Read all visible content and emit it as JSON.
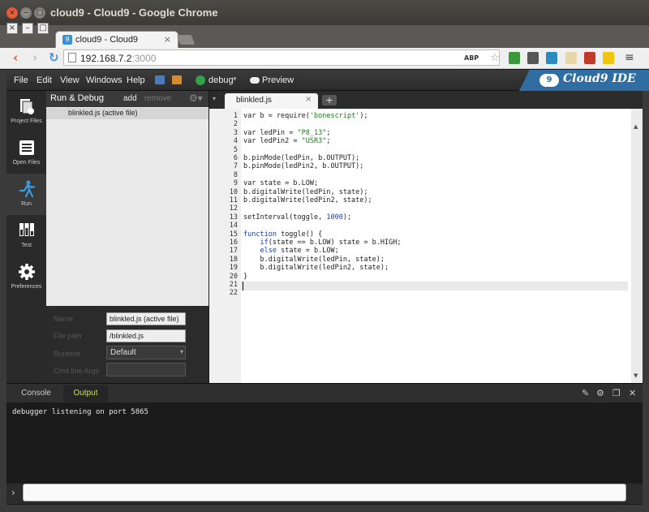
{
  "window": {
    "title": "cloud9 - Cloud9 - Google Chrome",
    "close": "×",
    "minimize": "–",
    "maximize": "□"
  },
  "browser": {
    "tab_controls": [
      "×",
      "–",
      "□"
    ],
    "tab_title": "cloud9 - Cloud9",
    "tab_close": "×",
    "favicon": "9",
    "url_host": "192.168.7.2",
    "url_port": ":3000",
    "extensions": [
      "ABP",
      "☆"
    ],
    "menu_glyph": "≡",
    "back_glyph": "‹",
    "forward_glyph": "›",
    "reload_glyph": "↻"
  },
  "ide": {
    "menu": [
      "File",
      "Edit",
      "View",
      "Windows",
      "Help"
    ],
    "debug_label": "debug",
    "debug_arrow": "▾",
    "preview_label": "Preview",
    "brand": "Cloud9 IDE",
    "brand_logo": "9"
  },
  "rail": [
    {
      "label": "Project Files",
      "icon": "project-files-icon"
    },
    {
      "label": "Open Files",
      "icon": "open-files-icon"
    },
    {
      "label": "Run",
      "icon": "run-icon"
    },
    {
      "label": "Test",
      "icon": "test-icon"
    },
    {
      "label": "Preferences",
      "icon": "gear-icon"
    }
  ],
  "panel": {
    "title": "Run & Debug",
    "add": "add",
    "remove": "remove",
    "gear": "⚙▾",
    "selected_row": "blinkled.js (active file)",
    "form": {
      "name_label": "Name",
      "name_value": "blinkled.js (active file)",
      "filepath_label": "File path",
      "filepath_value": "/blinkled.js",
      "runtime_label": "Runtime",
      "runtime_value": "Default",
      "args_label": "Cmd line Args",
      "args_value": ""
    }
  },
  "editor": {
    "tab_dropdown": "▾",
    "tab_label": "blinkled.js",
    "tab_close": "×",
    "new_tab": "+",
    "lines": [
      {
        "n": "1",
        "code": [
          [
            "t",
            "var b = require("
          ],
          [
            "s",
            "'bonescript'"
          ],
          [
            "t",
            ");"
          ]
        ]
      },
      {
        "n": "2",
        "code": []
      },
      {
        "n": "3",
        "code": [
          [
            "t",
            "var ledPin = "
          ],
          [
            "s",
            "\"P8_13\""
          ],
          [
            "t",
            ";"
          ]
        ]
      },
      {
        "n": "4",
        "code": [
          [
            "t",
            "var ledPin2 = "
          ],
          [
            "s",
            "\"USR3\""
          ],
          [
            "t",
            ";"
          ]
        ]
      },
      {
        "n": "5",
        "code": []
      },
      {
        "n": "6",
        "code": [
          [
            "t",
            "b.pinMode(ledPin, b.OUTPUT);"
          ]
        ]
      },
      {
        "n": "7",
        "code": [
          [
            "t",
            "b.pinMode(ledPin2, b.OUTPUT);"
          ]
        ]
      },
      {
        "n": "8",
        "code": []
      },
      {
        "n": "9",
        "code": [
          [
            "t",
            "var state = b.LOW;"
          ]
        ]
      },
      {
        "n": "10",
        "code": [
          [
            "t",
            "b.digitalWrite(ledPin, state);"
          ]
        ]
      },
      {
        "n": "11",
        "code": [
          [
            "t",
            "b.digitalWrite(ledPin2, state);"
          ]
        ]
      },
      {
        "n": "12",
        "code": []
      },
      {
        "n": "13",
        "code": [
          [
            "t",
            "setInterval(toggle, "
          ],
          [
            "n",
            "1000"
          ],
          [
            "t",
            ");"
          ]
        ]
      },
      {
        "n": "14",
        "code": []
      },
      {
        "n": "15",
        "code": [
          [
            "k",
            "function"
          ],
          [
            "t",
            " toggle() {"
          ]
        ]
      },
      {
        "n": "16",
        "code": [
          [
            "t",
            "    "
          ],
          [
            "k",
            "if"
          ],
          [
            "t",
            "(state == b.LOW) state = b.HIGH;"
          ]
        ]
      },
      {
        "n": "17",
        "code": [
          [
            "t",
            "    "
          ],
          [
            "k",
            "else"
          ],
          [
            "t",
            " state = b.LOW;"
          ]
        ]
      },
      {
        "n": "18",
        "code": [
          [
            "t",
            "    b.digitalWrite(ledPin, state);"
          ]
        ]
      },
      {
        "n": "19",
        "code": [
          [
            "t",
            "    b.digitalWrite(ledPin2, state);"
          ]
        ]
      },
      {
        "n": "20",
        "code": [
          [
            "t",
            "}"
          ]
        ]
      },
      {
        "n": "21",
        "code": []
      },
      {
        "n": "22",
        "code": []
      }
    ]
  },
  "console": {
    "tabs": [
      "Console",
      "Output"
    ],
    "active_tab": "Output",
    "tools": [
      "clear-icon",
      "gear-icon",
      "popout-icon",
      "close-icon"
    ],
    "output": "debugger listening on port 5865",
    "prompt": "›"
  }
}
